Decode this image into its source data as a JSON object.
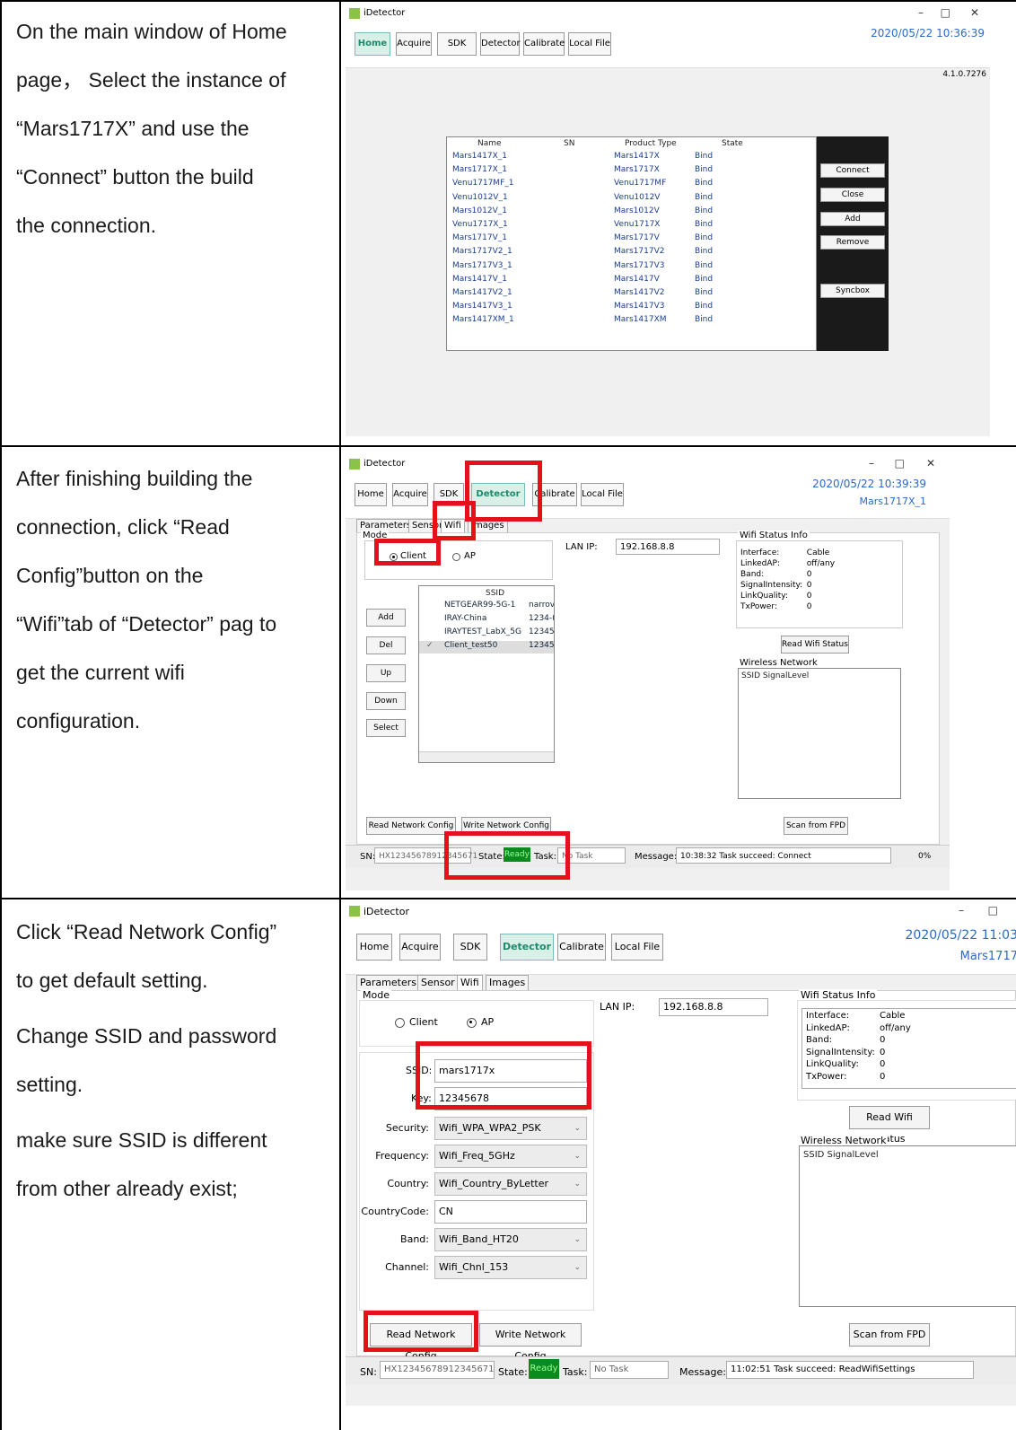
{
  "rows": [
    {
      "instruction": [
        "On the main window of Home",
        "page， Select the instance of",
        "“Mars1717X” and use the",
        "“Connect” button the build",
        "the connection."
      ]
    },
    {
      "instruction": [
        "After finishing building the",
        "connection, click “Read",
        "Config”button on the",
        "“Wifi”tab of “Detector” pag to",
        "get the current wifi",
        "configuration."
      ]
    },
    {
      "instruction": [
        "Click “Read Network Config”",
        "to get default setting.",
        "Change SSID and password",
        "setting.",
        "make sure SSID is different",
        "from other already exist;"
      ]
    }
  ],
  "app": {
    "title": "iDetector",
    "minimize": "–",
    "maximize": "□",
    "close": "✕",
    "nav": [
      "Home",
      "Acquire",
      "SDK",
      "Detector",
      "Calibrate",
      "Local File"
    ],
    "version": "4.1.0.7276"
  },
  "shot1": {
    "datetime": "2020/05/22 10:36:39",
    "columns": [
      "Name",
      "SN",
      "Product Type",
      "State"
    ],
    "instances": [
      {
        "name": "Mars1417X_1",
        "type": "Mars1417X",
        "state": "Bind"
      },
      {
        "name": "Mars1717X_1",
        "type": "Mars1717X",
        "state": "Bind"
      },
      {
        "name": "Venu1717MF_1",
        "type": "Venu1717MF",
        "state": "Bind"
      },
      {
        "name": "Venu1012V_1",
        "type": "Venu1012V",
        "state": "Bind"
      },
      {
        "name": "Mars1012V_1",
        "type": "Mars1012V",
        "state": "Bind"
      },
      {
        "name": "Venu1717X_1",
        "type": "Venu1717X",
        "state": "Bind"
      },
      {
        "name": "Mars1717V_1",
        "type": "Mars1717V",
        "state": "Bind"
      },
      {
        "name": "Mars1717V2_1",
        "type": "Mars1717V2",
        "state": "Bind"
      },
      {
        "name": "Mars1717V3_1",
        "type": "Mars1717V3",
        "state": "Bind"
      },
      {
        "name": "Mars1417V_1",
        "type": "Mars1417V",
        "state": "Bind"
      },
      {
        "name": "Mars1417V2_1",
        "type": "Mars1417V2",
        "state": "Bind"
      },
      {
        "name": "Mars1417V3_1",
        "type": "Mars1417V3",
        "state": "Bind"
      },
      {
        "name": "Mars1417XM_1",
        "type": "Mars1417XM",
        "state": "Bind"
      }
    ],
    "buttons": [
      "Connect",
      "Close",
      "Add",
      "Remove",
      "Syncbox"
    ]
  },
  "shot2": {
    "datetime": "2020/05/22 10:39:39",
    "instance": "Mars1717X_1",
    "tabs": [
      "Parameters",
      "Sensor",
      "Wifi",
      "Images"
    ],
    "mode_label": "Mode",
    "client": "Client",
    "ap": "AP",
    "lan_ip_label": "LAN IP:",
    "lan_ip": "192.168.8.8",
    "ssid_header": "SSID",
    "ssids": [
      {
        "ssid": "NETGEAR99-5G-1",
        "key": "narrov"
      },
      {
        "ssid": "IRAY-China",
        "key": "1234-("
      },
      {
        "ssid": "IRAYTEST_LabX_5G",
        "key": "12345("
      },
      {
        "ssid": "Client_test50",
        "key": "12345("
      }
    ],
    "side_buttons": [
      "Add",
      "Del",
      "Up",
      "Down",
      "Select"
    ],
    "wifi_status_title": "Wifi Status Info",
    "wifi_status": [
      {
        "k": "Interface:",
        "v": "Cable"
      },
      {
        "k": "LinkedAP:",
        "v": "off/any"
      },
      {
        "k": "Band:",
        "v": "0"
      },
      {
        "k": "SignalIntensity:",
        "v": "0"
      },
      {
        "k": "LinkQuality:",
        "v": "0"
      },
      {
        "k": "TxPower:",
        "v": "0"
      }
    ],
    "read_wifi_status": "Read Wifi Status",
    "wireless_title": "Wireless Network",
    "wireless_header": "SSID SignalLevel",
    "read_net": "Read Network Config",
    "write_net": "Write Network Config",
    "scan": "Scan from FPD",
    "sn_label": "SN:",
    "sn": "HX12345678912345671",
    "state_label": "State:",
    "state": "Ready",
    "task_label": "Task:",
    "task": "No Task",
    "message_label": "Message:",
    "message": "10:38:32 Task succeed: Connect",
    "percent": "0%"
  },
  "shot3": {
    "datetime": "2020/05/22 11:03",
    "instance": "Mars1717",
    "ssid_label": "SSID:",
    "ssid": "mars1717x",
    "key_label": "Key:",
    "key": "12345678",
    "fields": [
      {
        "label": "Security:",
        "value": "Wifi_WPA_WPA2_PSK",
        "combo": true
      },
      {
        "label": "Frequency:",
        "value": "Wifi_Freq_5GHz",
        "combo": true
      },
      {
        "label": "Country:",
        "value": "Wifi_Country_ByLetter",
        "combo": true
      },
      {
        "label": "CountryCode:",
        "value": "CN",
        "combo": false
      },
      {
        "label": "Band:",
        "value": "Wifi_Band_HT20",
        "combo": true
      },
      {
        "label": "Channel:",
        "value": "Wifi_Chnl_153",
        "combo": true
      }
    ],
    "message": "11:02:51 Task succeed: ReadWifiSettings",
    "chevron": "⌄"
  }
}
